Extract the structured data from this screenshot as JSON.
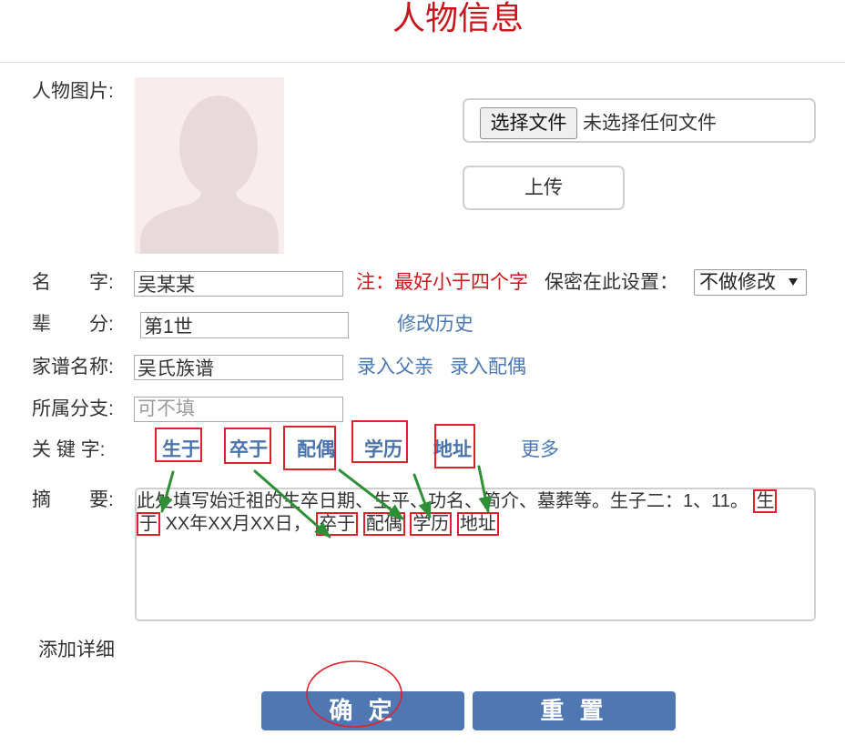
{
  "title": "人物信息",
  "photo": {
    "label": "人物图片:",
    "choose_file_button": "选择文件",
    "file_status": "未选择任何文件",
    "upload_button": "上传"
  },
  "name": {
    "label": "名　　字:",
    "value": "吴某某",
    "note": "注：最好小于四个字",
    "privacy_label": "保密在此设置：",
    "privacy_selected": "不做修改"
  },
  "generation": {
    "label": "辈　　分:",
    "value": "第1世",
    "history_link": "修改历史"
  },
  "genealogy": {
    "label": "家谱名称:",
    "value": "吴氏族谱",
    "add_father_link": "录入父亲",
    "add_spouse_link": "录入配偶"
  },
  "branch": {
    "label": "所属分支:",
    "placeholder": "可不填"
  },
  "keywords": {
    "label": "关 键 字:",
    "items": [
      "生于",
      "卒于",
      "配偶",
      "学历",
      "地址"
    ],
    "more_link": "更多"
  },
  "summary": {
    "label": "摘　　要:",
    "intro": "此处填写始迁祖的生卒日期、生平、功名、简介、墓葬等。生子二：1、11。",
    "birth": "生于",
    "birth_date": "XX年XX月XX日，",
    "death": "卒于",
    "spouse": "配偶",
    "education": "学历",
    "address": "地址"
  },
  "add_detail_link": "添加详细",
  "buttons": {
    "confirm": "确 定",
    "reset": "重 置"
  },
  "icons": {
    "avatar_placeholder": "person-silhouette-icon",
    "privacy_dropdown": "caret-down-icon"
  },
  "colors": {
    "title": "#c8161d",
    "note": "#d0161c",
    "link": "#4b78b4",
    "keyword": "#4a73ac",
    "button_bg": "#4f77b2",
    "annotation_red": "#e0202a",
    "annotation_green": "#2f8f37"
  }
}
